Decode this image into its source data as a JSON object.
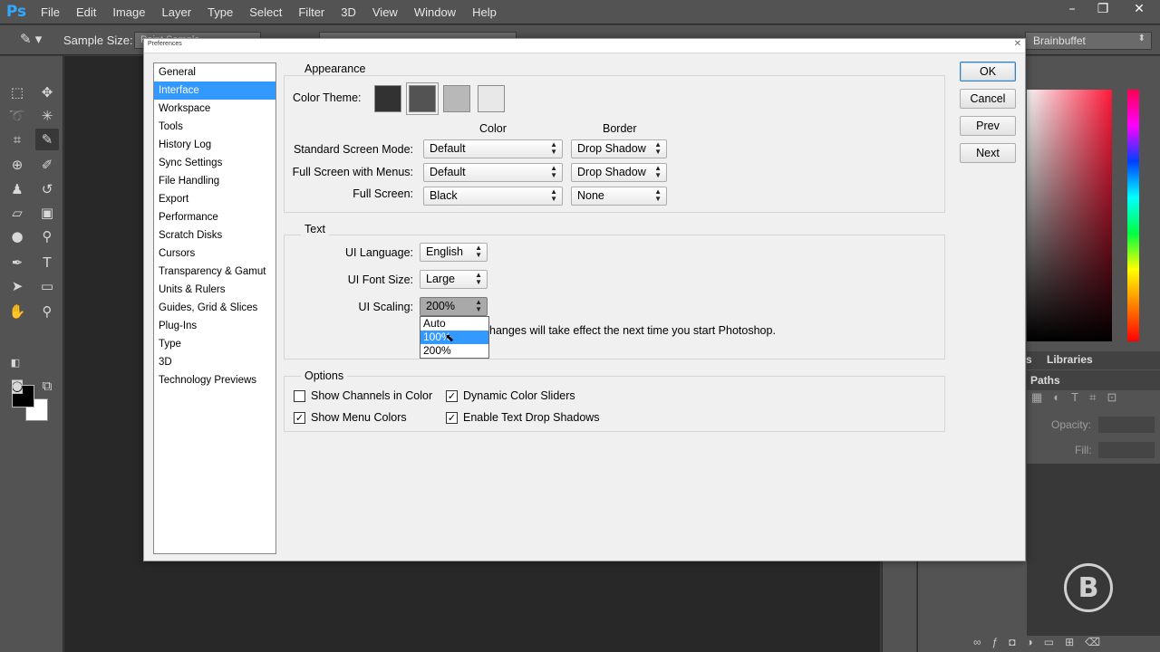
{
  "app": {
    "logo": "Ps",
    "menu": [
      "File",
      "Edit",
      "Image",
      "Layer",
      "Type",
      "Select",
      "Filter",
      "3D",
      "View",
      "Window",
      "Help"
    ],
    "window_controls": [
      "–",
      "❐",
      "✕"
    ]
  },
  "options_bar": {
    "sample_size_label": "Sample Size:",
    "sample_size_value": "Point Sample",
    "workspace": "Brainbuffet"
  },
  "right_panel": {
    "tabs": [
      "s",
      "Libraries"
    ],
    "paths_tab": "Paths",
    "opacity_label": "Opacity:",
    "fill_label": "Fill:",
    "icons": [
      "image-icon",
      "circle-icon",
      "text-icon",
      "transform-icon",
      "lock-icon"
    ],
    "footer_icons": [
      "link-icon",
      "fx-icon",
      "mask-icon",
      "adjustment-icon",
      "folder-icon",
      "new-layer-icon",
      "trash-icon"
    ],
    "watermark": "B",
    "spectrum_colors": {
      "top": "#f6f6f6",
      "right": "#ff1a3a"
    }
  },
  "dialog": {
    "title": "Preferences",
    "close": "✕",
    "categories": [
      "General",
      "Interface",
      "Workspace",
      "Tools",
      "History Log",
      "Sync Settings",
      "File Handling",
      "Export",
      "Performance",
      "Scratch Disks",
      "Cursors",
      "Transparency & Gamut",
      "Units & Rulers",
      "Guides, Grid & Slices",
      "Plug-Ins",
      "Type",
      "3D",
      "Technology Previews"
    ],
    "selected_category": "Interface",
    "appearance": {
      "title": "Appearance",
      "color_theme_label": "Color Theme:",
      "themes": [
        "#323232",
        "#535353",
        "#b8b8b8",
        "#e8e8e8"
      ],
      "selected_theme_index": 1,
      "col_color": "Color",
      "col_border": "Border",
      "rows": [
        {
          "label": "Standard Screen Mode:",
          "color": "Default",
          "border": "Drop Shadow"
        },
        {
          "label": "Full Screen with Menus:",
          "color": "Default",
          "border": "Drop Shadow"
        },
        {
          "label": "Full Screen:",
          "color": "Black",
          "border": "None"
        }
      ]
    },
    "text": {
      "title": "Text",
      "ui_language_label": "UI Language:",
      "ui_language": "English",
      "ui_font_size_label": "UI Font Size:",
      "ui_font_size": "Large",
      "ui_scaling_label": "UI Scaling:",
      "ui_scaling": "200%",
      "scaling_options": [
        "Auto",
        "100%",
        "200%"
      ],
      "highlighted_option": "100%",
      "note": "Changes will take effect the next time you start Photoshop."
    },
    "options": {
      "title": "Options",
      "checkboxes": [
        {
          "label": "Show Channels in Color",
          "checked": false
        },
        {
          "label": "Dynamic Color Sliders",
          "checked": true
        },
        {
          "label": "Show Menu Colors",
          "checked": true
        },
        {
          "label": "Enable Text Drop Shadows",
          "checked": true
        }
      ]
    },
    "buttons": {
      "ok": "OK",
      "cancel": "Cancel",
      "prev": "Prev",
      "next": "Next"
    }
  }
}
